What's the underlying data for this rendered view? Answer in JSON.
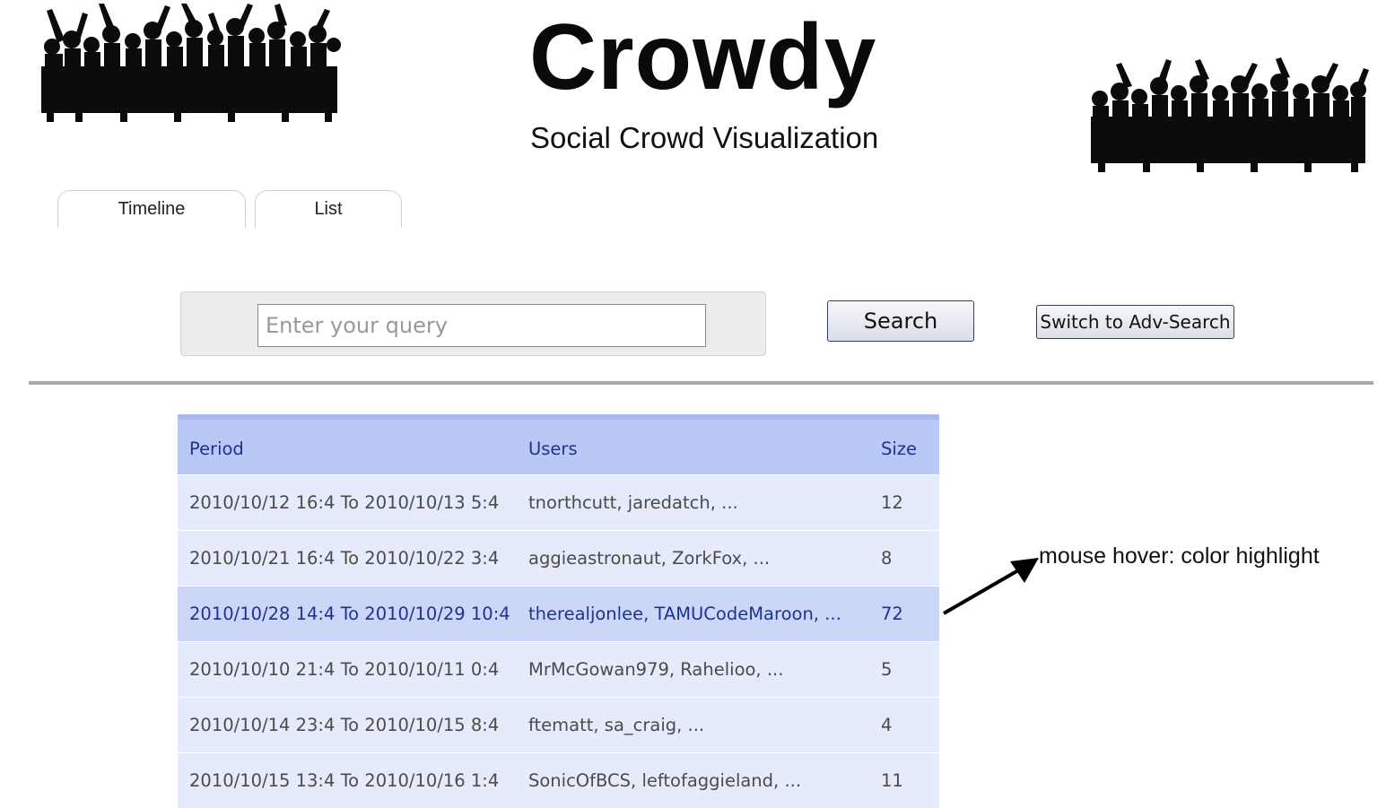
{
  "header": {
    "title": "Crowdy",
    "subtitle": "Social Crowd Visualization"
  },
  "tabs": [
    {
      "label": "Timeline"
    },
    {
      "label": "List"
    }
  ],
  "search": {
    "placeholder": "Enter your query",
    "value": "",
    "search_label": "Search",
    "adv_label": "Switch to Adv-Search"
  },
  "table": {
    "headers": {
      "period": "Period",
      "users": "Users",
      "size": "Size"
    },
    "rows": [
      {
        "period": "2010/10/12 16:4 To 2010/10/13 5:4",
        "users": "tnorthcutt, jaredatch, ...",
        "size": "12"
      },
      {
        "period": "2010/10/21 16:4 To 2010/10/22 3:4",
        "users": "aggieastronaut, ZorkFox, ...",
        "size": "8"
      },
      {
        "period": "2010/10/28 14:4 To 2010/10/29 10:4",
        "users": "therealjonlee, TAMUCodeMaroon, ...",
        "size": "72"
      },
      {
        "period": "2010/10/10 21:4 To 2010/10/11 0:4",
        "users": "MrMcGowan979, Rahelioo, ...",
        "size": "5"
      },
      {
        "period": "2010/10/14 23:4 To 2010/10/15 8:4",
        "users": "ftematt, sa_craig, ...",
        "size": "4"
      },
      {
        "period": "2010/10/15 13:4 To 2010/10/16 1:4",
        "users": "SonicOfBCS, leftofaggieland, ...",
        "size": "11"
      }
    ]
  },
  "annotation": {
    "text": "mouse hover: color highlight"
  },
  "colors": {
    "header_bg": "#b9c9f6",
    "row_bg": "#e6ebfb",
    "row_highlight_bg": "#ccd7f8",
    "header_text": "#1d3390"
  },
  "icons": [
    "crowd-silhouette-left",
    "crowd-silhouette-right",
    "arrow-icon"
  ]
}
